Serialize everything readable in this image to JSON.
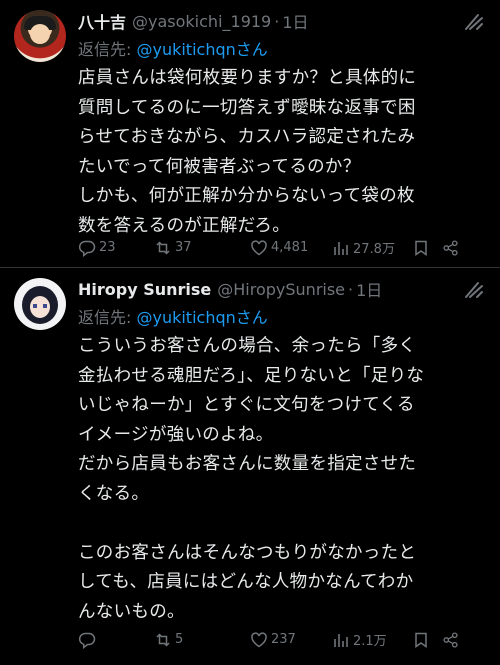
{
  "colors": {
    "background": "#000000",
    "text": "#e7e9ea",
    "muted": "#71767b",
    "link": "#1d9bf0",
    "divider": "#2f3336"
  },
  "tweets": [
    {
      "display_name": "八十吉",
      "handle": "@yasokichi_1919",
      "dot": "·",
      "time": "1日",
      "reply_prefix": "返信先: ",
      "reply_to": "@yukitichqnさん",
      "text": "店員さんは袋何枚要りますか？と具体的に\n質問してるのに一切答えず曖昧な返事で困\nらせておきながら、カスハラ認定されたみ\nたいでって何被害者ぶってるのか？\nしかも、何が正解か分からないって袋の枚\n数を答えるのが正解だろ。",
      "replies": "23",
      "retweets": "37",
      "likes": "4,481",
      "views": "27.8万"
    },
    {
      "display_name": "Hiropy Sunrise",
      "handle": "@HiropySunrise",
      "dot": "·",
      "time": "1日",
      "reply_prefix": "返信先: ",
      "reply_to": "@yukitichqnさん",
      "text": "こういうお客さんの場合、余ったら「多く\n金払わせる魂胆だろ」、足りないと「足りな\nいじゃねーか」とすぐに文句をつけてくる\nイメージが強いのよね。\nだから店員もお客さんに数量を指定させた\nくなる。\n\nこのお客さんはそんなつもりがなかったと\nしても、店員にはどんな人物かなんてわか\nんないもの。",
      "replies": "",
      "retweets": "5",
      "likes": "237",
      "views": "2.1万"
    }
  ]
}
